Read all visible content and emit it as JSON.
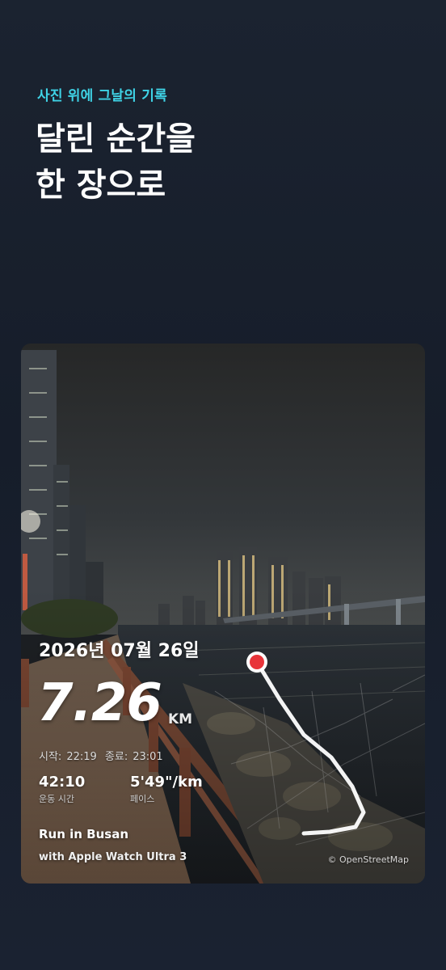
{
  "header": {
    "eyebrow": "사진 위에 그날의 기록",
    "headline_line1": "달린 순간을",
    "headline_line2": "한 장으로"
  },
  "card": {
    "date": "2026년 07월 26일",
    "distance": "7.26",
    "distance_unit": "KM",
    "start_label": "시작:",
    "start_time": "22:19",
    "end_label": "종료:",
    "end_time": "23:01",
    "duration_value": "42:10",
    "duration_label": "운동 시간",
    "pace_value": "5'49\"/km",
    "pace_label": "페이스",
    "run_title": "Run in Busan",
    "device": "with Apple Watch Ultra 3",
    "map_attribution": "© OpenStreetMap"
  },
  "colors": {
    "accent": "#3fd3e6",
    "start_marker": "#e8343a",
    "route": "#ffffff"
  }
}
